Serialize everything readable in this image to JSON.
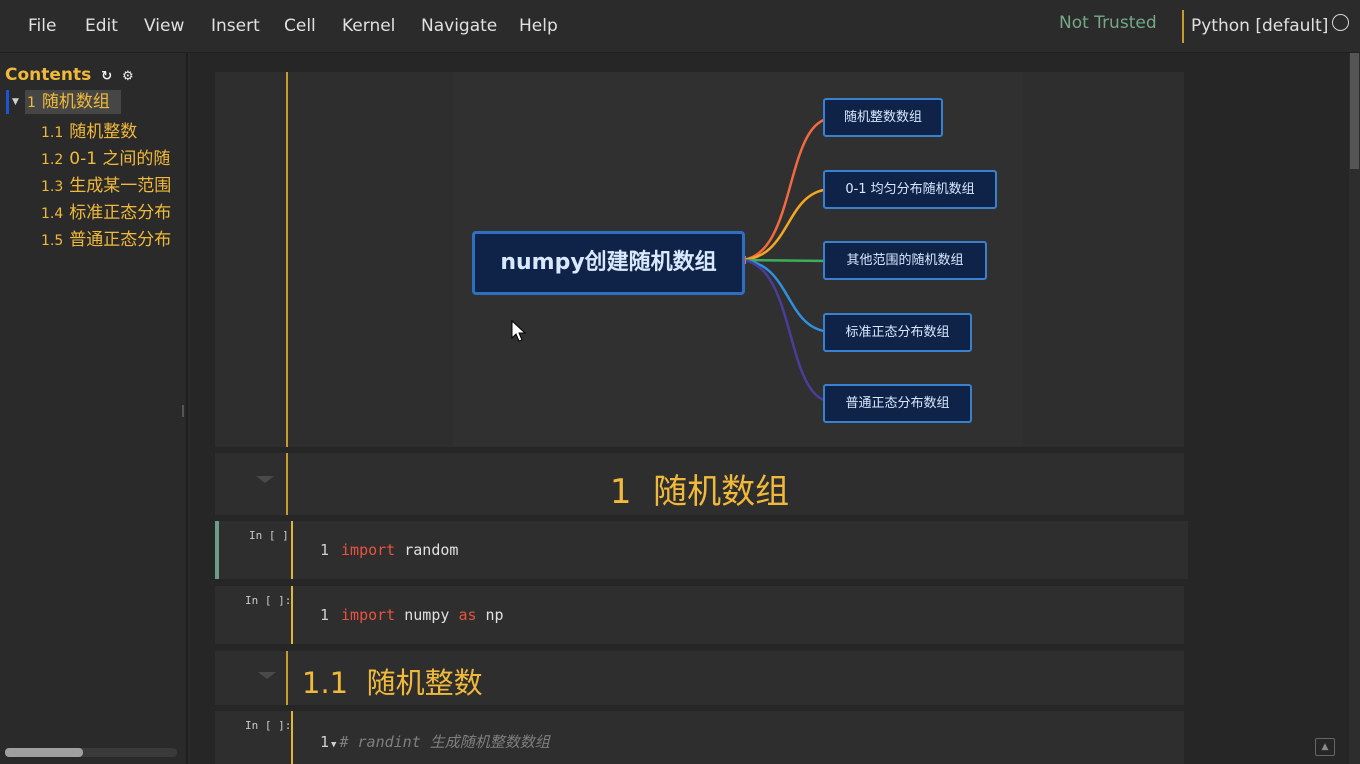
{
  "menubar": {
    "items": [
      "File",
      "Edit",
      "View",
      "Insert",
      "Cell",
      "Kernel",
      "Navigate",
      "Help"
    ],
    "trust_status": "Not Trusted",
    "kernel_name": "Python [default]"
  },
  "toc": {
    "title": "Contents",
    "header_icons": [
      "refresh-icon",
      "gear-icon"
    ],
    "items": [
      {
        "num": "1",
        "label": "随机数组"
      },
      {
        "num": "1.1",
        "label": "随机整数"
      },
      {
        "num": "1.2",
        "label": "0-1 之间的随"
      },
      {
        "num": "1.3",
        "label": "生成某一范围"
      },
      {
        "num": "1.4",
        "label": "标准正态分布"
      },
      {
        "num": "1.5",
        "label": "普通正态分布"
      }
    ]
  },
  "mindmap": {
    "root": "numpy创建随机数组",
    "branches": [
      {
        "label": "随机整数数组",
        "color": "#f26a3d"
      },
      {
        "label": "0-1 均匀分布随机数组",
        "color": "#f5a623"
      },
      {
        "label": "其他范围的随机数组",
        "color": "#3fae5a"
      },
      {
        "label": "标准正态分布数组",
        "color": "#2f8fe0"
      },
      {
        "label": "普通正态分布数组",
        "color": "#4b3d9a"
      }
    ]
  },
  "cells": {
    "heading1": {
      "number": "1",
      "title": "随机数组"
    },
    "code1": {
      "prompt": "In [ ]:",
      "line_no": "1",
      "keyword": "import",
      "rest": " random"
    },
    "code2": {
      "prompt": "In [ ]:",
      "line_no": "1",
      "keyword": "import",
      "mid": " numpy ",
      "keyword2": "as",
      "rest": " np"
    },
    "heading2": {
      "number": "1.1",
      "title": "随机整数"
    },
    "code3": {
      "prompt": "In [ ]:",
      "line_no": "1",
      "comment": "# randint 生成随机整数数组"
    }
  }
}
